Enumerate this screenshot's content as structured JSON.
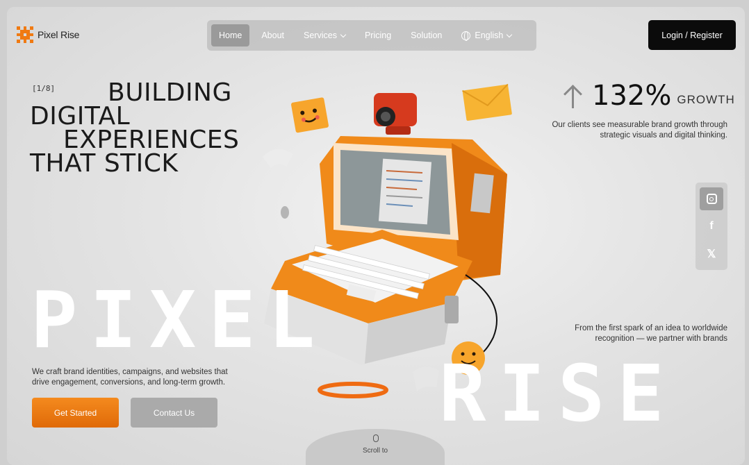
{
  "brand": {
    "name": "Pixel Rise",
    "accent": "#f07a12"
  },
  "nav": {
    "items": [
      {
        "label": "Home",
        "active": true
      },
      {
        "label": "About"
      },
      {
        "label": "Services",
        "dropdown": true
      },
      {
        "label": "Pricing"
      },
      {
        "label": "Solution"
      }
    ],
    "language": "English"
  },
  "header": {
    "login_label": "Login / Register"
  },
  "hero": {
    "counter": "[1/8]",
    "line1": "BUILDING",
    "line2": "DIGITAL",
    "line3": "EXPERIENCES",
    "line4": "THAT STICK",
    "pixel_word_1": "PIXEL",
    "pixel_word_2": "RISE",
    "description": "We craft brand identities, campaigns, and websites that drive engagement, conversions, and long-term growth.",
    "cta_primary": "Get Started",
    "cta_secondary": "Contact Us"
  },
  "growth": {
    "value": "132%",
    "label": "GROWTH",
    "description": "Our clients see measurable brand growth through strategic visuals and digital thinking."
  },
  "right_text": "From the first spark of an idea to worldwide recognition — we partner with brands",
  "socials": [
    {
      "icon": "instagram-icon"
    },
    {
      "icon": "facebook-icon"
    },
    {
      "icon": "x-icon"
    }
  ],
  "scroll": {
    "label": "Scroll to"
  }
}
